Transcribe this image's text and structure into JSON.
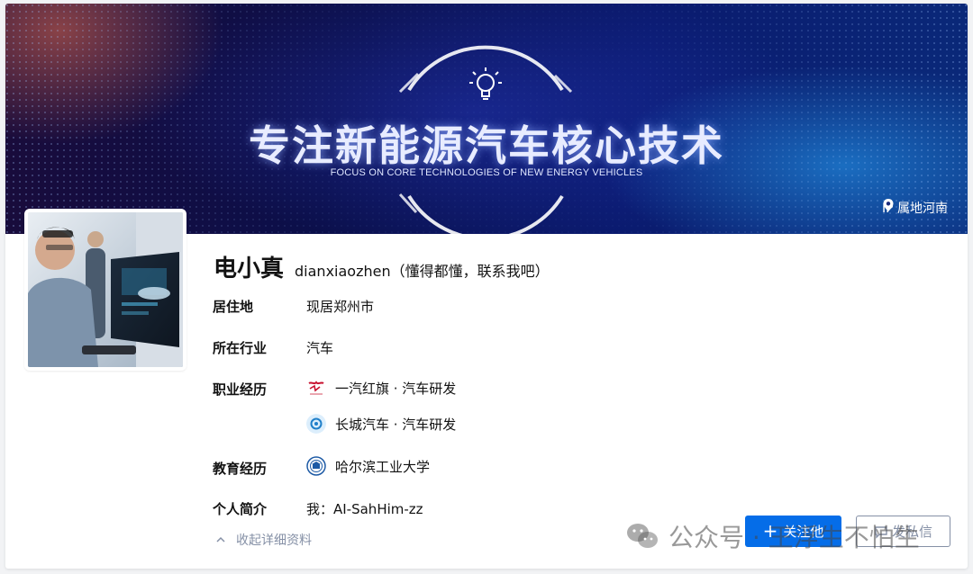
{
  "banner": {
    "title": "专注新能源汽车核心技术",
    "subtitle": "FOCUS ON CORE TECHNOLOGIES OF NEW ENERGY VEHICLES",
    "ip_location": "IP 属地河南"
  },
  "profile": {
    "name": "电小真",
    "headline": "dianxiaozhen（懂得都懂，联系我吧）",
    "residence": {
      "label": "居住地",
      "value": "现居郑州市"
    },
    "industry": {
      "label": "所在行业",
      "value": "汽车"
    },
    "career": {
      "label": "职业经历",
      "items": [
        {
          "text": "一汽红旗 · 汽车研发",
          "logo": "hongqi-logo"
        },
        {
          "text": "长城汽车 · 汽车研发",
          "logo": "great-wall-logo"
        }
      ]
    },
    "education": {
      "label": "教育经历",
      "items": [
        {
          "text": "哈尔滨工业大学",
          "logo": "hit-logo"
        }
      ]
    },
    "bio": {
      "label": "个人简介",
      "value": "我：AI-SahHim-zz"
    },
    "collapse_label": "收起详细资料"
  },
  "actions": {
    "follow_label": "关注他",
    "message_label": "发私信"
  },
  "watermark": {
    "text": "公众号 · 王浮生不怕生"
  },
  "colors": {
    "primary": "#056de8",
    "muted": "#8590a6"
  }
}
